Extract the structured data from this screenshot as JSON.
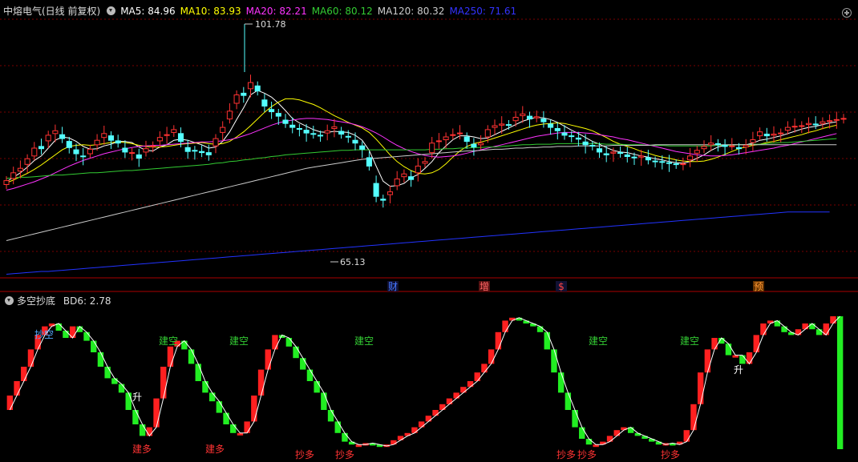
{
  "header": {
    "title": "中熔电气(日线 前复权)",
    "ma": [
      {
        "label": "MA5: 84.96",
        "color": "#ffffff"
      },
      {
        "label": "MA10: 83.93",
        "color": "#ffff00"
      },
      {
        "label": "MA20: 82.21",
        "color": "#ff33ff"
      },
      {
        "label": "MA60: 80.12",
        "color": "#33cc33"
      },
      {
        "label": "MA120: 80.32",
        "color": "#cccccc"
      },
      {
        "label": "MA250: 71.61",
        "color": "#3333ff"
      }
    ]
  },
  "indicator_header": {
    "title": "多空抄底",
    "value_label": "BD6: 2.78"
  },
  "chart_data": [
    {
      "type": "candlestick",
      "ylim": [
        60,
        106
      ],
      "high_label": "101.78",
      "low_label": "65.13",
      "event_markers": [
        "财",
        "增",
        "$",
        "预"
      ],
      "ma_series": [
        "MA5",
        "MA10",
        "MA20",
        "MA60",
        "MA120",
        "MA250"
      ],
      "close": [
        77.2,
        78.6,
        79.4,
        81.1,
        83.0,
        82.9,
        85.3,
        86.1,
        84.7,
        83.1,
        82.0,
        81.5,
        82.8,
        84.4,
        85.6,
        84.4,
        83.9,
        82.3,
        82.2,
        81.2,
        82.9,
        83.4,
        84.9,
        85.4,
        86.3,
        84.2,
        82.4,
        82.5,
        82.2,
        81.8,
        84.7,
        86.7,
        89.6,
        92.5,
        92.4,
        94.7,
        93.2,
        90.5,
        89.5,
        88.7,
        87.4,
        86.7,
        86.4,
        85.7,
        85.5,
        85.2,
        86.1,
        86.8,
        85.5,
        85.0,
        83.9,
        82.8,
        79.8,
        74.4,
        73.7,
        75.2,
        77.5,
        78.4,
        77.4,
        79.8,
        80.6,
        83.9,
        84.3,
        85.0,
        85.4,
        85.7,
        84.2,
        83.2,
        83.9,
        86.3,
        87.0,
        87.3,
        87.1,
        88.5,
        89.1,
        88.2,
        88.6,
        87.7,
        86.7,
        86.1,
        85.3,
        85.1,
        84.6,
        83.6,
        83.4,
        82.3,
        81.8,
        82.3,
        82.1,
        81.5,
        81.3,
        81.6,
        80.9,
        80.6,
        80.5,
        80.3,
        80.1,
        80.2,
        81.6,
        82.6,
        83.3,
        83.9,
        83.7,
        83.3,
        83.4,
        82.9,
        83.5,
        84.5,
        85.9,
        85.2,
        85.5,
        85.7,
        86.7,
        86.9,
        87.0,
        87.4,
        87.2,
        87.7,
        87.9,
        88.1,
        88.3
      ],
      "open": [
        76.5,
        77.6,
        78.9,
        80.1,
        81.6,
        83.3,
        84.3,
        85.6,
        85.4,
        84.2,
        82.7,
        81.6,
        82.0,
        83.6,
        84.9,
        85.2,
        84.3,
        83.0,
        82.1,
        81.8,
        82.3,
        83.3,
        84.3,
        85.3,
        85.8,
        85.6,
        83.1,
        82.6,
        82.4,
        82.2,
        83.4,
        85.8,
        88.2,
        91.0,
        92.8,
        93.6,
        94.1,
        91.6,
        89.9,
        89.2,
        88.0,
        87.1,
        86.5,
        86.2,
        85.6,
        85.3,
        85.7,
        86.5,
        86.0,
        85.1,
        84.4,
        83.4,
        81.3,
        76.7,
        73.9,
        74.7,
        76.3,
        77.9,
        77.9,
        78.6,
        80.3,
        82.2,
        84.2,
        84.5,
        85.3,
        85.6,
        85.0,
        83.7,
        83.6,
        85.0,
        86.7,
        87.1,
        87.2,
        87.9,
        88.8,
        88.7,
        88.4,
        88.2,
        87.3,
        86.5,
        85.7,
        85.2,
        84.8,
        84.1,
        83.5,
        82.9,
        82.0,
        82.1,
        82.2,
        81.8,
        81.4,
        81.4,
        81.3,
        80.7,
        80.6,
        80.4,
        80.2,
        80.1,
        80.9,
        82.1,
        82.9,
        83.6,
        83.8,
        83.5,
        83.4,
        83.1,
        83.2,
        84.0,
        85.2,
        85.5,
        85.3,
        85.6,
        86.2,
        86.8,
        87.0,
        87.2,
        87.3,
        87.4,
        87.8,
        88.0,
        88.2
      ],
      "MA5": [
        77.0,
        77.8,
        78.6,
        79.6,
        80.8,
        81.6,
        83.0,
        84.4,
        85.0,
        84.8,
        84.2,
        83.3,
        82.8,
        82.9,
        83.4,
        83.7,
        84.2,
        84.2,
        84.0,
        83.2,
        82.6,
        82.5,
        83.2,
        83.6,
        84.4,
        84.6,
        84.4,
        84.0,
        83.6,
        83.0,
        83.2,
        84.2,
        85.9,
        88.1,
        90.2,
        92.5,
        93.3,
        92.8,
        92.1,
        91.0,
        89.7,
        88.3,
        87.5,
        86.9,
        86.3,
        85.9,
        85.8,
        86.0,
        85.9,
        85.8,
        85.3,
        84.4,
        82.6,
        79.8,
        77.1,
        76.2,
        76.3,
        76.7,
        77.7,
        78.3,
        79.4,
        80.6,
        82.2,
        83.4,
        84.5,
        85.2,
        85.2,
        85.0,
        84.7,
        84.8,
        85.4,
        86.0,
        86.6,
        87.2,
        87.8,
        88.2,
        88.5,
        88.4,
        88.1,
        87.6,
        86.9,
        86.2,
        85.6,
        84.9,
        84.2,
        83.7,
        83.1,
        82.6,
        82.3,
        82.2,
        81.9,
        81.6,
        81.4,
        81.1,
        80.9,
        80.6,
        80.4,
        80.3,
        80.6,
        81.2,
        81.8,
        82.6,
        83.2,
        83.5,
        83.6,
        83.6,
        83.6,
        83.9,
        84.4,
        84.6,
        84.9,
        85.2,
        85.6,
        86.0,
        86.4,
        86.7,
        86.9,
        87.2,
        87.5,
        87.7,
        84.96
      ],
      "MA10": [
        76.8,
        77.3,
        77.9,
        78.5,
        79.2,
        80.0,
        80.9,
        81.8,
        82.7,
        83.3,
        83.5,
        83.6,
        83.5,
        83.6,
        83.8,
        84.0,
        84.1,
        84.0,
        83.8,
        83.5,
        83.3,
        83.2,
        83.2,
        83.3,
        83.5,
        83.7,
        83.8,
        83.9,
        84.0,
        83.8,
        83.7,
        83.8,
        84.2,
        85.0,
        85.9,
        87.0,
        88.2,
        89.4,
        90.4,
        91.2,
        91.8,
        91.8,
        91.6,
        91.2,
        90.8,
        90.2,
        89.5,
        88.8,
        88.2,
        87.6,
        87.1,
        86.6,
        85.8,
        84.6,
        83.2,
        81.8,
        80.6,
        79.7,
        79.0,
        78.5,
        78.4,
        78.6,
        79.2,
        80.2,
        81.4,
        82.5,
        83.3,
        83.8,
        84.1,
        84.4,
        84.8,
        85.2,
        85.6,
        86.0,
        86.4,
        86.8,
        87.1,
        87.3,
        87.4,
        87.5,
        87.4,
        87.1,
        86.8,
        86.5,
        86.1,
        85.5,
        84.9,
        84.2,
        83.7,
        83.3,
        82.9,
        82.4,
        82.1,
        81.7,
        81.4,
        81.2,
        80.9,
        80.7,
        80.6,
        80.6,
        80.7,
        81.0,
        81.4,
        81.9,
        82.4,
        82.9,
        83.2,
        83.5,
        83.7,
        84.0,
        84.2,
        84.5,
        84.8,
        85.1,
        85.4,
        85.8,
        86.1,
        86.5,
        86.8,
        87.1,
        83.93
      ],
      "MA20": [
        75.5,
        75.8,
        76.2,
        76.6,
        77.0,
        77.5,
        78.0,
        78.6,
        79.2,
        79.8,
        80.3,
        80.8,
        81.2,
        81.6,
        82.0,
        82.3,
        82.6,
        82.9,
        83.1,
        83.3,
        83.4,
        83.5,
        83.5,
        83.6,
        83.7,
        83.8,
        83.9,
        84.0,
        84.1,
        84.1,
        84.2,
        84.3,
        84.5,
        84.8,
        85.2,
        85.6,
        86.1,
        86.6,
        87.1,
        87.5,
        87.8,
        88.0,
        88.2,
        88.3,
        88.3,
        88.2,
        88.1,
        87.9,
        87.7,
        87.5,
        87.2,
        86.8,
        86.3,
        85.7,
        85.0,
        84.2,
        83.5,
        82.9,
        82.4,
        82.0,
        81.7,
        81.5,
        81.4,
        81.5,
        81.6,
        81.8,
        82.1,
        82.4,
        82.7,
        83.0,
        83.3,
        83.6,
        83.9,
        84.2,
        84.5,
        84.8,
        85.1,
        85.3,
        85.5,
        85.7,
        85.8,
        85.8,
        85.8,
        85.7,
        85.6,
        85.4,
        85.2,
        85.0,
        84.7,
        84.5,
        84.2,
        83.9,
        83.6,
        83.3,
        83.0,
        82.7,
        82.4,
        82.2,
        82.0,
        81.8,
        81.7,
        81.6,
        81.6,
        81.7,
        81.8,
        82.0,
        82.2,
        82.4,
        82.6,
        82.8,
        83.0,
        83.3,
        83.5,
        83.8,
        84.1,
        84.4,
        84.7,
        85.0,
        85.3,
        85.6,
        82.21
      ],
      "MA60": [
        77.6,
        77.7,
        77.8,
        77.8,
        77.9,
        78.0,
        78.1,
        78.2,
        78.2,
        78.3,
        78.4,
        78.5,
        78.6,
        78.6,
        78.7,
        78.8,
        78.9,
        79.0,
        79.0,
        79.1,
        79.2,
        79.3,
        79.4,
        79.5,
        79.6,
        79.7,
        79.8,
        79.9,
        80.0,
        80.1,
        80.3,
        80.4,
        80.6,
        80.7,
        80.9,
        81.0,
        81.2,
        81.3,
        81.5,
        81.6,
        81.8,
        81.9,
        82.0,
        82.1,
        82.2,
        82.3,
        82.4,
        82.5,
        82.6,
        82.6,
        82.7,
        82.7,
        82.7,
        82.7,
        82.7,
        82.7,
        82.7,
        82.7,
        82.7,
        82.7,
        82.7,
        82.8,
        82.8,
        82.9,
        82.9,
        83.0,
        83.0,
        83.1,
        83.1,
        83.2,
        83.2,
        83.3,
        83.4,
        83.5,
        83.6,
        83.6,
        83.7,
        83.7,
        83.7,
        83.8,
        83.8,
        83.8,
        83.8,
        83.8,
        83.8,
        83.8,
        83.7,
        83.7,
        83.7,
        83.6,
        83.6,
        83.6,
        83.5,
        83.5,
        83.5,
        83.4,
        83.4,
        83.4,
        83.4,
        83.4,
        83.4,
        83.4,
        83.5,
        83.5,
        83.5,
        83.6,
        83.6,
        83.7,
        83.7,
        83.8,
        83.9,
        84.0,
        84.0,
        84.1,
        84.2,
        84.3,
        84.4,
        84.5,
        84.6,
        84.7,
        80.12
      ],
      "MA120": [
        66.5,
        66.8,
        67.1,
        67.4,
        67.7,
        68.0,
        68.3,
        68.6,
        68.9,
        69.2,
        69.5,
        69.8,
        70.1,
        70.4,
        70.7,
        71.0,
        71.3,
        71.6,
        71.9,
        72.2,
        72.5,
        72.8,
        73.1,
        73.4,
        73.7,
        74.0,
        74.3,
        74.6,
        74.9,
        75.2,
        75.5,
        75.8,
        76.1,
        76.4,
        76.7,
        77.0,
        77.3,
        77.6,
        77.9,
        78.2,
        78.5,
        78.8,
        79.1,
        79.4,
        79.6,
        79.8,
        80.0,
        80.2,
        80.4,
        80.6,
        80.8,
        81.0,
        81.1,
        81.2,
        81.3,
        81.4,
        81.5,
        81.6,
        81.7,
        81.8,
        81.9,
        82.0,
        82.1,
        82.2,
        82.3,
        82.4,
        82.5,
        82.5,
        82.6,
        82.7,
        82.8,
        82.8,
        82.9,
        83.0,
        83.0,
        83.1,
        83.1,
        83.2,
        83.2,
        83.3,
        83.3,
        83.3,
        83.4,
        83.4,
        83.4,
        83.4,
        83.4,
        83.5,
        83.5,
        83.5,
        83.5,
        83.5,
        83.5,
        83.6,
        83.6,
        83.6,
        83.6,
        83.6,
        83.6,
        83.6,
        83.6,
        83.6,
        83.6,
        83.6,
        83.6,
        83.6,
        83.6,
        83.6,
        83.6,
        83.6,
        83.6,
        83.6,
        83.6,
        83.6,
        83.6,
        83.6,
        83.6,
        83.6,
        83.6,
        83.6,
        80.32
      ],
      "MA250": [
        60.5,
        60.6,
        60.7,
        60.8,
        60.9,
        61.0,
        61.0,
        61.1,
        61.2,
        61.3,
        61.4,
        61.5,
        61.6,
        61.7,
        61.8,
        61.9,
        62.0,
        62.1,
        62.2,
        62.3,
        62.4,
        62.5,
        62.6,
        62.7,
        62.8,
        62.9,
        63.0,
        63.1,
        63.2,
        63.3,
        63.4,
        63.5,
        63.6,
        63.7,
        63.8,
        63.9,
        64.0,
        64.1,
        64.2,
        64.3,
        64.4,
        64.5,
        64.6,
        64.7,
        64.8,
        64.9,
        65.0,
        65.1,
        65.2,
        65.3,
        65.4,
        65.5,
        65.6,
        65.7,
        65.8,
        65.9,
        66.0,
        66.1,
        66.2,
        66.3,
        66.4,
        66.5,
        66.6,
        66.7,
        66.8,
        66.9,
        67.0,
        67.1,
        67.2,
        67.3,
        67.4,
        67.5,
        67.6,
        67.7,
        67.8,
        67.9,
        68.0,
        68.1,
        68.2,
        68.3,
        68.4,
        68.5,
        68.6,
        68.7,
        68.8,
        68.9,
        69.0,
        69.1,
        69.2,
        69.3,
        69.4,
        69.5,
        69.6,
        69.7,
        69.8,
        69.9,
        70.0,
        70.1,
        70.2,
        70.3,
        70.4,
        70.5,
        70.6,
        70.7,
        70.8,
        70.9,
        71.0,
        71.1,
        71.2,
        71.3,
        71.4,
        71.5,
        71.6,
        71.6,
        71.6,
        71.6,
        71.6,
        71.6,
        71.61
      ]
    },
    {
      "type": "bar",
      "series_name": "BD6",
      "ylim": [
        0,
        100
      ],
      "labels": {
        "buy_low": "抄空",
        "build_short": "建空",
        "build_long": "建多",
        "cover_long": "抄多",
        "rise": "升"
      },
      "values": [
        30,
        40,
        50,
        60,
        72,
        82,
        88,
        90,
        85,
        80,
        88,
        84,
        78,
        70,
        60,
        52,
        48,
        42,
        30,
        20,
        12,
        18,
        38,
        60,
        74,
        78,
        72,
        62,
        50,
        42,
        36,
        28,
        20,
        14,
        14,
        22,
        40,
        58,
        72,
        82,
        80,
        74,
        66,
        58,
        50,
        42,
        30,
        22,
        14,
        8,
        6,
        6,
        7,
        6,
        5,
        6,
        9,
        12,
        14,
        18,
        22,
        26,
        30,
        34,
        38,
        42,
        46,
        50,
        56,
        62,
        72,
        84,
        92,
        94,
        92,
        90,
        88,
        84,
        72,
        56,
        42,
        30,
        18,
        10,
        6,
        6,
        8,
        12,
        16,
        18,
        14,
        12,
        10,
        8,
        6,
        7,
        6,
        8,
        16,
        34,
        56,
        72,
        80,
        76,
        68,
        68,
        62,
        70,
        82,
        90,
        92,
        88,
        84,
        82,
        86,
        90,
        86,
        82,
        90,
        95,
        2.78
      ]
    }
  ]
}
